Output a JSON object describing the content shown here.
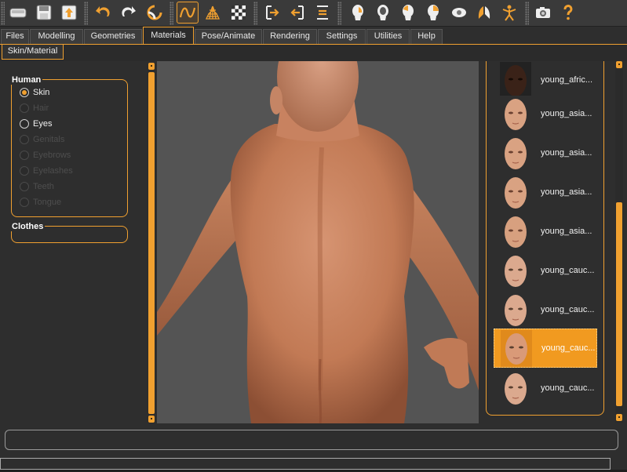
{
  "toolbar": {
    "buttons": [
      {
        "icon": "disk-drive-icon"
      },
      {
        "icon": "save-icon"
      },
      {
        "icon": "export-icon"
      },
      {
        "icon": "undo-icon"
      },
      {
        "icon": "redo-icon"
      },
      {
        "icon": "reset-icon"
      },
      {
        "icon": "smooth-icon"
      },
      {
        "icon": "wireframe-icon"
      },
      {
        "icon": "background-checker-icon"
      },
      {
        "icon": "front-view-icon"
      },
      {
        "icon": "back-view-icon"
      },
      {
        "icon": "left-view-icon"
      },
      {
        "icon": "right-view-icon"
      },
      {
        "icon": "top-view-icon"
      },
      {
        "icon": "bottom-view-icon"
      },
      {
        "icon": "reset-camera-icon"
      },
      {
        "icon": "pose-icon"
      },
      {
        "icon": "grab-screen-icon"
      },
      {
        "icon": "help-icon"
      }
    ],
    "accent": "#f0a030"
  },
  "tabs": [
    "Files",
    "Modelling",
    "Geometries",
    "Materials",
    "Pose/Animate",
    "Rendering",
    "Settings",
    "Utilities",
    "Help"
  ],
  "active_tab": "Materials",
  "subtabs": [
    "Skin/Material"
  ],
  "human_group": {
    "title": "Human",
    "options": [
      {
        "label": "Skin",
        "checked": true,
        "enabled": true
      },
      {
        "label": "Hair",
        "checked": false,
        "enabled": false
      },
      {
        "label": "Eyes",
        "checked": false,
        "enabled": true
      },
      {
        "label": "Genitals",
        "checked": false,
        "enabled": false
      },
      {
        "label": "Eyebrows",
        "checked": false,
        "enabled": false
      },
      {
        "label": "Eyelashes",
        "checked": false,
        "enabled": false
      },
      {
        "label": "Teeth",
        "checked": false,
        "enabled": false
      },
      {
        "label": "Tongue",
        "checked": false,
        "enabled": false
      }
    ]
  },
  "clothes_group": {
    "title": "Clothes"
  },
  "materials": [
    {
      "label": "young_afric...",
      "tone": "dark",
      "selected": false
    },
    {
      "label": "young_asia...",
      "tone": "light",
      "selected": false
    },
    {
      "label": "young_asia...",
      "tone": "light",
      "selected": false
    },
    {
      "label": "young_asia...",
      "tone": "light",
      "selected": false
    },
    {
      "label": "young_asia...",
      "tone": "light",
      "selected": false
    },
    {
      "label": "young_cauc...",
      "tone": "light",
      "selected": false
    },
    {
      "label": "young_cauc...",
      "tone": "light",
      "selected": false
    },
    {
      "label": "young_cauc...",
      "tone": "light",
      "selected": true
    },
    {
      "label": "young_cauc...",
      "tone": "light",
      "selected": false
    }
  ],
  "colors": {
    "accent": "#f0a030",
    "selection": "#f19a20",
    "viewport_bg": "#545454",
    "skin": "#c9805a"
  }
}
